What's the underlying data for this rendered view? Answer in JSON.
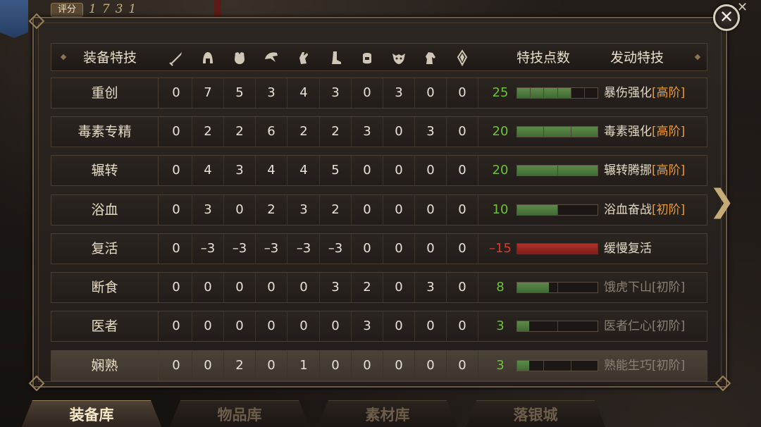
{
  "score": {
    "label": "评分",
    "value": "1731"
  },
  "header": {
    "title": "装备特技",
    "slot_icons": [
      "sword-icon",
      "helmet-icon",
      "chest-armor-icon",
      "shoulder-icon",
      "glove-icon",
      "boot-icon",
      "belt-icon",
      "mask-icon",
      "horse-icon",
      "pendant-icon"
    ],
    "points_label": "特技点数",
    "active_label": "发动特技"
  },
  "rows": [
    {
      "name": "重创",
      "values": [
        "0",
        "7",
        "5",
        "3",
        "4",
        "3",
        "0",
        "3",
        "0",
        "0"
      ],
      "points": "25",
      "skill": "暴伤强化",
      "tier": "[高阶]",
      "segments": 6,
      "filled": 4,
      "dim": false,
      "neg": false
    },
    {
      "name": "毒素专精",
      "values": [
        "0",
        "2",
        "2",
        "6",
        "2",
        "2",
        "3",
        "0",
        "3",
        "0"
      ],
      "points": "20",
      "skill": "毒素强化",
      "tier": "[高阶]",
      "segments": 3,
      "filled": 3,
      "dim": false,
      "neg": false
    },
    {
      "name": "辗转",
      "values": [
        "0",
        "4",
        "3",
        "4",
        "4",
        "5",
        "0",
        "0",
        "0",
        "0"
      ],
      "points": "20",
      "skill": "辗转腾挪",
      "tier": "[高阶]",
      "segments": 2,
      "filled": 2,
      "dim": false,
      "neg": false
    },
    {
      "name": "浴血",
      "values": [
        "0",
        "3",
        "0",
        "2",
        "3",
        "2",
        "0",
        "0",
        "0",
        "0"
      ],
      "points": "10",
      "skill": "浴血奋战",
      "tier": "[初阶]",
      "segments": 2,
      "filled": 1,
      "dim": false,
      "neg": false
    },
    {
      "name": "复活",
      "values": [
        "0",
        "–3",
        "–3",
        "–3",
        "–3",
        "–3",
        "0",
        "0",
        "0",
        "0"
      ],
      "points": "–15",
      "skill": "缓慢复活",
      "tier": "",
      "segments": 1,
      "filled": 1,
      "dim": false,
      "neg": true
    },
    {
      "name": "断食",
      "values": [
        "0",
        "0",
        "0",
        "0",
        "0",
        "3",
        "2",
        "0",
        "3",
        "0"
      ],
      "points": "8",
      "skill": "饿虎下山",
      "tier": "[初阶]",
      "segments": 2,
      "filled": 0.8,
      "dim": true,
      "neg": false
    },
    {
      "name": "医者",
      "values": [
        "0",
        "0",
        "0",
        "0",
        "0",
        "0",
        "3",
        "0",
        "0",
        "0"
      ],
      "points": "3",
      "skill": "医者仁心",
      "tier": "[初阶]",
      "segments": 2,
      "filled": 0.3,
      "dim": true,
      "neg": false
    },
    {
      "name": "娴熟",
      "values": [
        "0",
        "0",
        "2",
        "0",
        "1",
        "0",
        "0",
        "0",
        "0",
        "0"
      ],
      "points": "3",
      "skill": "熟能生巧",
      "tier": "[初阶]",
      "segments": 3,
      "filled": 0.45,
      "dim": true,
      "neg": false
    }
  ],
  "tabs": [
    {
      "label": "装备库",
      "active": true
    },
    {
      "label": "物品库",
      "active": false
    },
    {
      "label": "素材库",
      "active": false
    },
    {
      "label": "落银城",
      "active": false
    }
  ],
  "colors": {
    "positive": "#6cc33a",
    "negative": "#e2362a",
    "tier": "#e89a3b",
    "bar_green": "#4f7a3f",
    "bar_red": "#a52a22"
  }
}
